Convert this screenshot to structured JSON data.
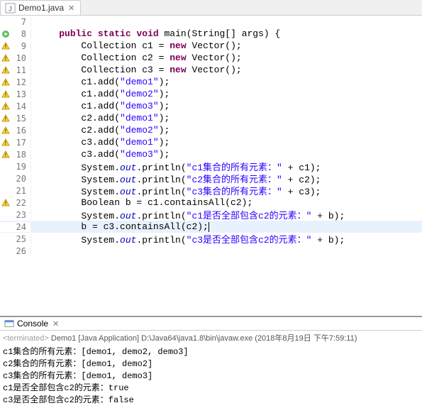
{
  "tab": {
    "title": "Demo1.java",
    "close": "✕"
  },
  "lines": [
    {
      "n": 7,
      "marker": "",
      "ind": 1,
      "tokens": []
    },
    {
      "n": 8,
      "marker": "run",
      "ind": 1,
      "tokens": [
        [
          "kw",
          "public"
        ],
        [
          "",
          " "
        ],
        [
          "kw",
          "static"
        ],
        [
          "",
          " "
        ],
        [
          "kw",
          "void"
        ],
        [
          "",
          " main(String[] args) {"
        ]
      ]
    },
    {
      "n": 9,
      "marker": "warn",
      "ind": 2,
      "tokens": [
        [
          "",
          "Collection c1 = "
        ],
        [
          "kw",
          "new"
        ],
        [
          "",
          " Vector();"
        ]
      ]
    },
    {
      "n": 10,
      "marker": "warn",
      "ind": 2,
      "tokens": [
        [
          "",
          "Collection c2 = "
        ],
        [
          "kw",
          "new"
        ],
        [
          "",
          " Vector();"
        ]
      ]
    },
    {
      "n": 11,
      "marker": "warn",
      "ind": 2,
      "tokens": [
        [
          "",
          "Collection c3 = "
        ],
        [
          "kw",
          "new"
        ],
        [
          "",
          " Vector();"
        ]
      ]
    },
    {
      "n": 12,
      "marker": "warn",
      "ind": 2,
      "tokens": [
        [
          "",
          "c1.add("
        ],
        [
          "str",
          "\"demo1\""
        ],
        [
          "",
          ");"
        ]
      ]
    },
    {
      "n": 13,
      "marker": "warn",
      "ind": 2,
      "tokens": [
        [
          "",
          "c1.add("
        ],
        [
          "str",
          "\"demo2\""
        ],
        [
          "",
          ");"
        ]
      ]
    },
    {
      "n": 14,
      "marker": "warn",
      "ind": 2,
      "tokens": [
        [
          "",
          "c1.add("
        ],
        [
          "str",
          "\"demo3\""
        ],
        [
          "",
          ");"
        ]
      ]
    },
    {
      "n": 15,
      "marker": "warn",
      "ind": 2,
      "tokens": [
        [
          "",
          "c2.add("
        ],
        [
          "str",
          "\"demo1\""
        ],
        [
          "",
          ");"
        ]
      ]
    },
    {
      "n": 16,
      "marker": "warn",
      "ind": 2,
      "tokens": [
        [
          "",
          "c2.add("
        ],
        [
          "str",
          "\"demo2\""
        ],
        [
          "",
          ");"
        ]
      ]
    },
    {
      "n": 17,
      "marker": "warn",
      "ind": 2,
      "tokens": [
        [
          "",
          "c3.add("
        ],
        [
          "str",
          "\"demo1\""
        ],
        [
          "",
          ");"
        ]
      ]
    },
    {
      "n": 18,
      "marker": "warn",
      "ind": 2,
      "tokens": [
        [
          "",
          "c3.add("
        ],
        [
          "str",
          "\"demo3\""
        ],
        [
          "",
          ");"
        ]
      ]
    },
    {
      "n": 19,
      "marker": "",
      "ind": 2,
      "tokens": [
        [
          "",
          "System."
        ],
        [
          "fld",
          "out"
        ],
        [
          "",
          ".println("
        ],
        [
          "str",
          "\"c1集合的所有元素：\""
        ],
        [
          "",
          " + c1);"
        ]
      ]
    },
    {
      "n": 20,
      "marker": "",
      "ind": 2,
      "tokens": [
        [
          "",
          "System."
        ],
        [
          "fld",
          "out"
        ],
        [
          "",
          ".println("
        ],
        [
          "str",
          "\"c2集合的所有元素：\""
        ],
        [
          "",
          " + c2);"
        ]
      ]
    },
    {
      "n": 21,
      "marker": "",
      "ind": 2,
      "tokens": [
        [
          "",
          "System."
        ],
        [
          "fld",
          "out"
        ],
        [
          "",
          ".println("
        ],
        [
          "str",
          "\"c3集合的所有元素：\""
        ],
        [
          "",
          " + c3);"
        ]
      ]
    },
    {
      "n": 22,
      "marker": "warn",
      "ind": 2,
      "tokens": [
        [
          "",
          "Boolean b = c1.containsAll(c2);"
        ]
      ]
    },
    {
      "n": 23,
      "marker": "",
      "ind": 2,
      "tokens": [
        [
          "",
          "System."
        ],
        [
          "fld",
          "out"
        ],
        [
          "",
          ".println("
        ],
        [
          "str",
          "\"c1是否全部包含c2的元素：\""
        ],
        [
          "",
          " + b);"
        ]
      ]
    },
    {
      "n": 24,
      "marker": "",
      "hl": true,
      "ind": 2,
      "tokens": [
        [
          "",
          "b = c3.containsAll(c2);"
        ],
        [
          "caret",
          ""
        ]
      ]
    },
    {
      "n": 25,
      "marker": "",
      "ind": 2,
      "tokens": [
        [
          "",
          "System."
        ],
        [
          "fld",
          "out"
        ],
        [
          "",
          ".println("
        ],
        [
          "str",
          "\"c3是否全部包含c2的元素：\""
        ],
        [
          "",
          " + b);"
        ]
      ]
    },
    {
      "n": 26,
      "marker": "",
      "ind": 1,
      "tokens": []
    }
  ],
  "console": {
    "title": "Console",
    "status_prefix": "<terminated>",
    "status_rest": " Demo1 [Java Application] D:\\Java64\\java1.8\\bin\\javaw.exe (2018年8月19日 下午7:59:11)",
    "out": [
      "c1集合的所有元素：[demo1, demo2, demo3]",
      "c2集合的所有元素：[demo1, demo2]",
      "c3集合的所有元素：[demo1, demo3]",
      "c1是否全部包含c2的元素：true",
      "c3是否全部包含c2的元素：false"
    ]
  }
}
